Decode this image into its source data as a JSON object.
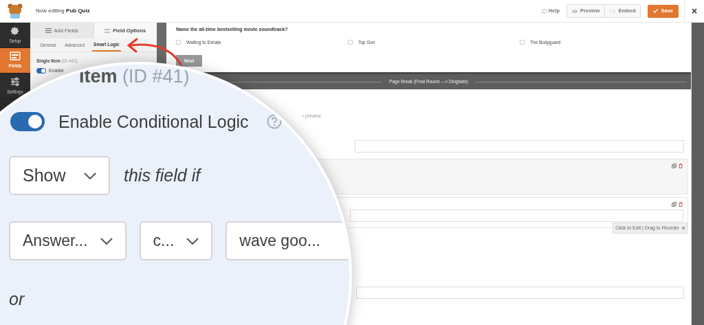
{
  "header": {
    "prefix": "Now editing",
    "form_name": "Pub Quiz",
    "help": "Help",
    "preview": "Preview",
    "embed": "Embed",
    "save": "Save"
  },
  "nav": [
    {
      "label": "Setup",
      "kind": "gear",
      "selected": false
    },
    {
      "label": "Fields",
      "kind": "fields",
      "selected": true
    },
    {
      "label": "Settings",
      "kind": "sliders",
      "selected": false
    }
  ],
  "panel": {
    "tabs": [
      {
        "label": "Add Fields",
        "kind": "list",
        "selected": false
      },
      {
        "label": "Field Options",
        "kind": "sliders",
        "selected": true
      }
    ],
    "subtabs": [
      {
        "label": "General",
        "selected": false
      },
      {
        "label": "Advanced",
        "selected": false
      },
      {
        "label": "Smart Logic",
        "selected": true
      }
    ],
    "field_title": "Single Item",
    "field_id": "(ID #41)",
    "toggle": {
      "label": "Enable",
      "on": true
    }
  },
  "canvas": {
    "question": "Name the all-time bestselling movie soundtrack?",
    "choices": [
      {
        "label": "Waiting to Exhale",
        "checked": false
      },
      {
        "label": "Top Gun",
        "checked": false
      },
      {
        "label": "The Bodyguard",
        "checked": false
      }
    ],
    "next": "Next",
    "page_break": "Page Break (Final Round ---> Dingbats)",
    "hint": "r preview.",
    "hover_tag": "Click to Edit | Drag to Reorder"
  },
  "magnifier": {
    "title": "Item",
    "id": "(ID #41)",
    "toggle": {
      "label": "Enable Conditional Logic",
      "on": true
    },
    "action": "Show",
    "action_suffix": "this field if",
    "rule": [
      {
        "kind": "select",
        "value": "Answer..."
      },
      {
        "kind": "select",
        "value": "c..."
      },
      {
        "kind": "input",
        "value": "wave goo..."
      }
    ],
    "or": "or"
  }
}
